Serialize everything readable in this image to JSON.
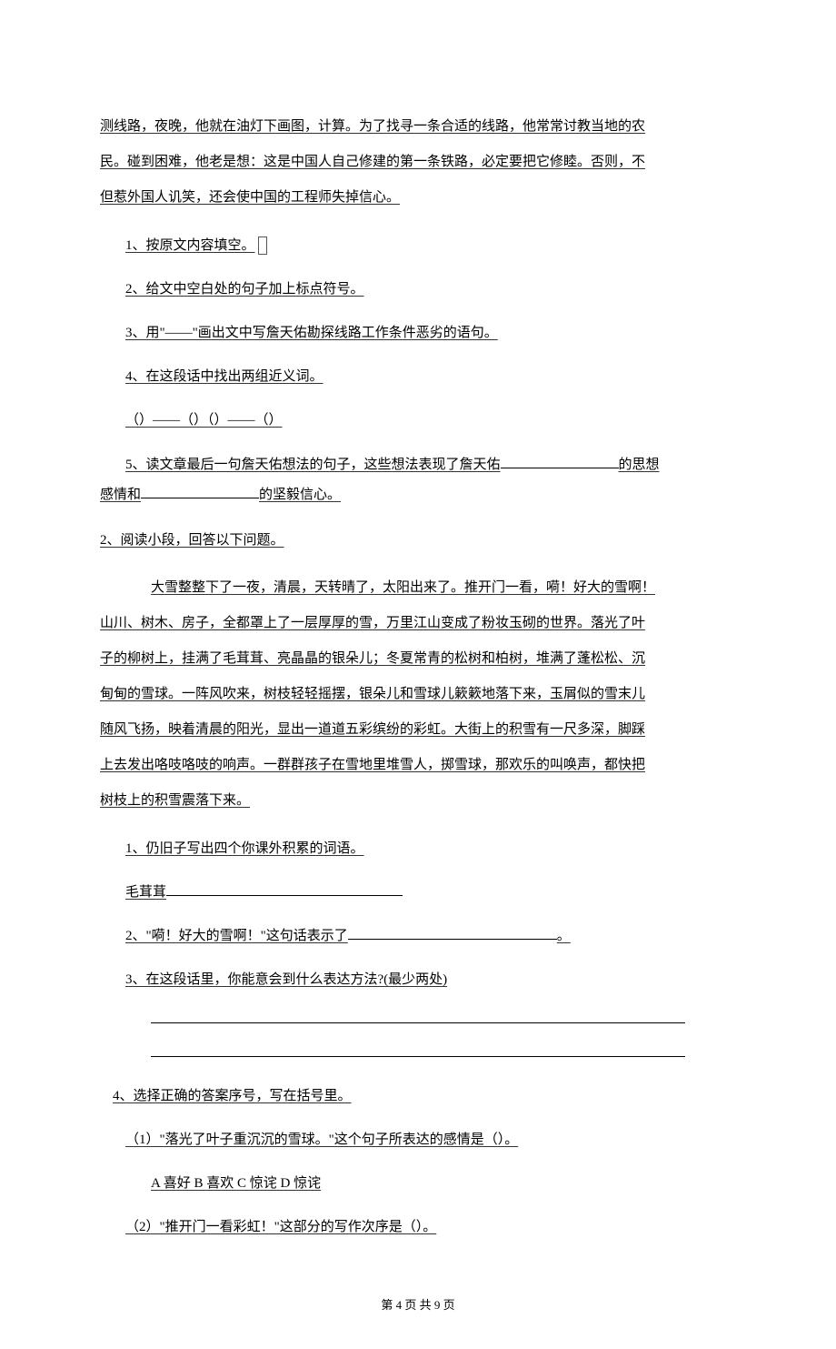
{
  "intro": {
    "line1": "测线路，夜晚，他就在油灯下画图，计算。为了找寻一条合适的线路，他常常讨教当地的农",
    "line2": "民。碰到困难，他老是想：这是中国人自己修建的第一条铁路，必定要把它修睦。否则，不",
    "line3": "但惹外国人讥笑，还会使中国的工程师失掉信心。"
  },
  "q1": {
    "item1": "1、按原文内容填空。",
    "item2": "2、给文中空白处的句子加上标点符号。",
    "item3": "3、用\"——\"画出文中写詹天佑勘探线路工作条件恶劣的语句。",
    "item4": "4、在这段话中找出两组近义词。",
    "item4_fill": "（）——（）（）——（）",
    "item5_a": "5、读文章最后一句詹天佑想法的句子，这些想法表现了詹天佑",
    "item5_b": "的思想",
    "item5_c": "感情和",
    "item5_d": "的坚毅信心。"
  },
  "q2": {
    "header": "2、阅读小段，回答以下问题。",
    "passage_indent": "大雪整整下了一夜，清晨，天转晴了，太阳出来了。推开门一看，嗬！好大的雪啊！",
    "passage_lines": [
      "山川、树木、房子，全都罩上了一层厚厚的雪，万里江山变成了粉妆玉砌的世界。落光了叶",
      "子的柳树上，挂满了毛茸茸、亮晶晶的银朵儿；冬夏常青的松树和柏树，堆满了蓬松松、沉",
      "甸甸的雪球。一阵风吹来，树枝轻轻摇摆，银朵儿和雪球儿簌簌地落下来，玉屑似的雪末儿",
      "随风飞扬，映着清晨的阳光，显出一道道五彩缤纷的彩虹。大街上的积雪有一尺多深，脚踩",
      "上去发出咯吱咯吱的响声。一群群孩子在雪地里堆雪人，掷雪球，那欢乐的叫唤声，都快把",
      "树枝上的积雪震落下来。"
    ],
    "item1": "1、仍旧子写出四个你课外积累的词语。",
    "item1_label": "毛茸茸",
    "item2_a": "2、\"嗬！好大的雪啊！\"这句话表示了",
    "item2_b": "。",
    "item3": "3、在这段话里，你能意会到什么表达方法?(最少两处)",
    "item4": "4、选择正确的答案序号，写在括号里。",
    "item4_1": "（1）\"落光了叶子重沉沉的雪球。\"这个句子所表达的感情是（）。",
    "item4_1_opts": "A 喜好 B 喜欢 C 惊诧 D 惊诧",
    "item4_2": "（2）\"推开门一看彩虹！\"这部分的写作次序是（）。"
  },
  "footer": "第 4 页 共 9 页"
}
